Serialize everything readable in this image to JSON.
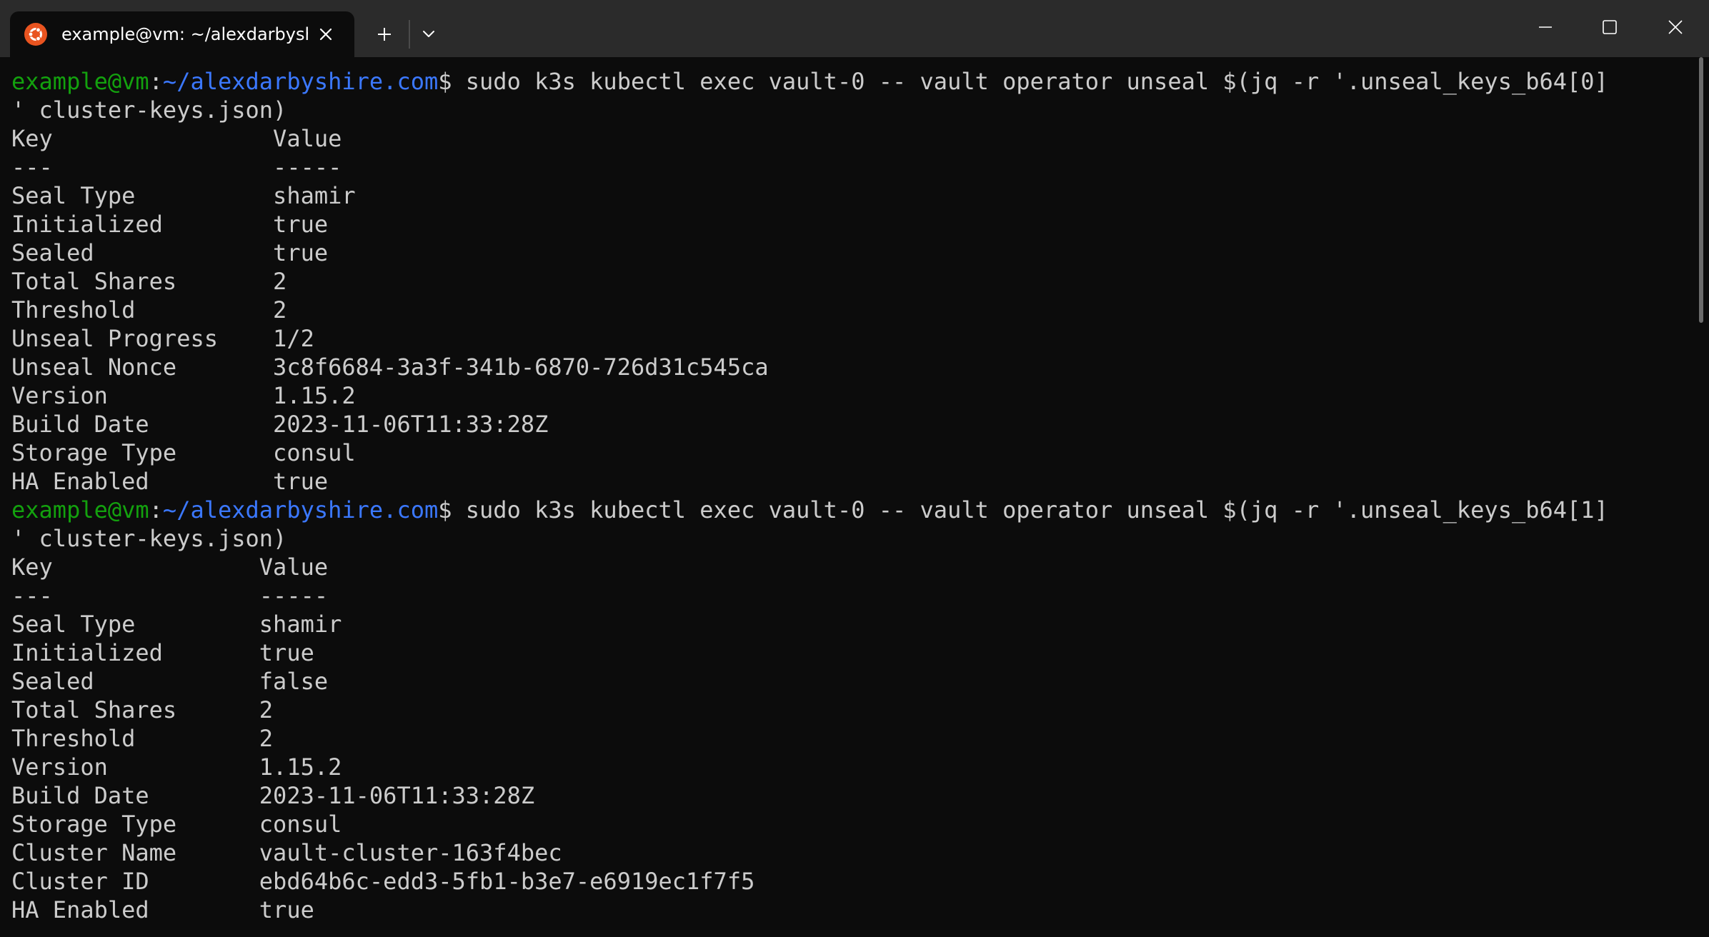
{
  "window": {
    "tab_title": "example@vm: ~/alexdarbyshire.com",
    "tab_icon": "ubuntu-icon",
    "new_tab_icon": "plus-icon",
    "dropdown_icon": "chevron-down-icon",
    "controls": [
      "minimize-icon",
      "maximize-icon",
      "close-icon"
    ]
  },
  "colors": {
    "user": "#13a10e",
    "path": "#3b78ff",
    "text": "#cccccc",
    "background": "#0c0c0c",
    "titlebar": "#2b2b2b",
    "accent": "#e95420"
  },
  "terminal": {
    "prompt_user": "example@vm",
    "prompt_colon": ":",
    "prompt_path": "~/alexdarbyshire.com",
    "prompt_dollar": "$",
    "commands": [
      {
        "command": " sudo k3s kubectl exec vault-0 -- vault operator unseal $(jq -r '.unseal_keys_b64[0]",
        "command_wrap": "' cluster-keys.json)",
        "output": [
          "Key                Value",
          "---                -----",
          "Seal Type          shamir",
          "Initialized        true",
          "Sealed             true",
          "Total Shares       2",
          "Threshold          2",
          "Unseal Progress    1/2",
          "Unseal Nonce       3c8f6684-3a3f-341b-6870-726d31c545ca",
          "Version            1.15.2",
          "Build Date         2023-11-06T11:33:28Z",
          "Storage Type       consul",
          "HA Enabled         true"
        ]
      },
      {
        "command": " sudo k3s kubectl exec vault-0 -- vault operator unseal $(jq -r '.unseal_keys_b64[1]",
        "command_wrap": "' cluster-keys.json)",
        "output": [
          "Key               Value",
          "---               -----",
          "Seal Type         shamir",
          "Initialized       true",
          "Sealed            false",
          "Total Shares      2",
          "Threshold         2",
          "Version           1.15.2",
          "Build Date        2023-11-06T11:33:28Z",
          "Storage Type      consul",
          "Cluster Name      vault-cluster-163f4bec",
          "Cluster ID        ebd64b6c-edd3-5fb1-b3e7-e6919ec1f7f5",
          "HA Enabled        true"
        ]
      }
    ]
  }
}
